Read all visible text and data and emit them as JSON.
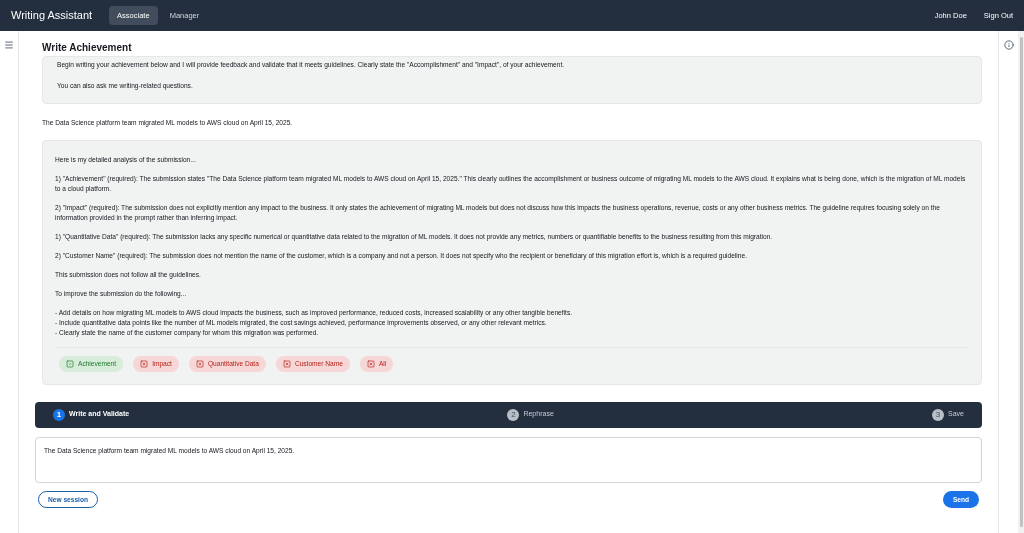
{
  "nav": {
    "brand": "Writing Assistant",
    "tabs": [
      {
        "label": "Associate",
        "selected": true
      },
      {
        "label": "Manager",
        "selected": false
      }
    ],
    "user": "John Doe",
    "sign_out": "Sign Out"
  },
  "page": {
    "title": "Write Achievement"
  },
  "intro": [
    "Begin writing your achievement below and I will provide feedback and validate that it meets guidelines. Clearly state the \"Accomplishment\" and \"Impact\", of your achievement.",
    "You can also ask me writing-related questions."
  ],
  "user_message": "The Data Science platform team migrated ML models to AWS cloud on April 15, 2025.",
  "analysis": {
    "blocks": [
      {
        "kind": "paragraph",
        "text": "Here is my detailed analysis of the submission..."
      },
      {
        "kind": "paragraph",
        "text": "1) \"Achievement\" (required): The submission states \"The Data Science platform team migrated ML models to AWS cloud on April 15, 2025.\" This clearly outlines the accomplishment or business outcome of migrating ML models to the AWS cloud. It explains what is being done, which is the migration of ML models to a cloud platform."
      },
      {
        "kind": "paragraph",
        "text": "2) \"Impact\" (required): The submission does not explicitly mention any impact to the business. It only states the achievement of migrating ML models but does not discuss how this impacts the business operations, revenue, costs or any other business metrics. The guideline requires focusing solely on the information provided in the prompt rather than inferring impact."
      },
      {
        "kind": "paragraph",
        "text": "1) \"Quantitative Data\" (required): The submission lacks any specific numerical or quantitative data related to the migration of ML models. It does not provide any metrics, numbers or quantifiable benefits to the business resulting from this migration."
      },
      {
        "kind": "paragraph",
        "text": "2) \"Customer Name\" (required): The submission does not mention the name of the customer, which is a company and not a person. It does not specify who the recipient or beneficiary of this migration effort is, which is a required guideline."
      },
      {
        "kind": "paragraph",
        "text": "This submission does not follow all the guidelines."
      },
      {
        "kind": "paragraph",
        "text": "To improve the submission do the following..."
      },
      {
        "kind": "lines",
        "lines": [
          "- Add details on how migrating ML models to AWS cloud impacts the business, such as improved performance, reduced costs, increased scalability or any other tangible benefits.",
          "- Include quantitative data points like the number of ML models migrated, the cost savings achieved, performance improvements observed, or any other relevant metrics.",
          "- Clearly state the name of the customer company for whom this migration was performed."
        ]
      }
    ],
    "tags": [
      {
        "label": "Achievement",
        "passed": true
      },
      {
        "label": "Impact",
        "passed": false
      },
      {
        "label": "Quantitative Data",
        "passed": false
      },
      {
        "label": "Customer Name",
        "passed": false
      },
      {
        "label": "All",
        "passed": false
      }
    ]
  },
  "steps": [
    {
      "number": "1",
      "label": "Write and Validate",
      "selected": true
    },
    {
      "number": "2",
      "label": "Rephrase",
      "selected": false
    },
    {
      "number": "3",
      "label": "Save",
      "selected": false
    }
  ],
  "composer": {
    "value": "The Data Science platform team migrated ML models to AWS cloud on April 15, 2025."
  },
  "buttons": {
    "new_session": "New session",
    "send": "Send"
  }
}
